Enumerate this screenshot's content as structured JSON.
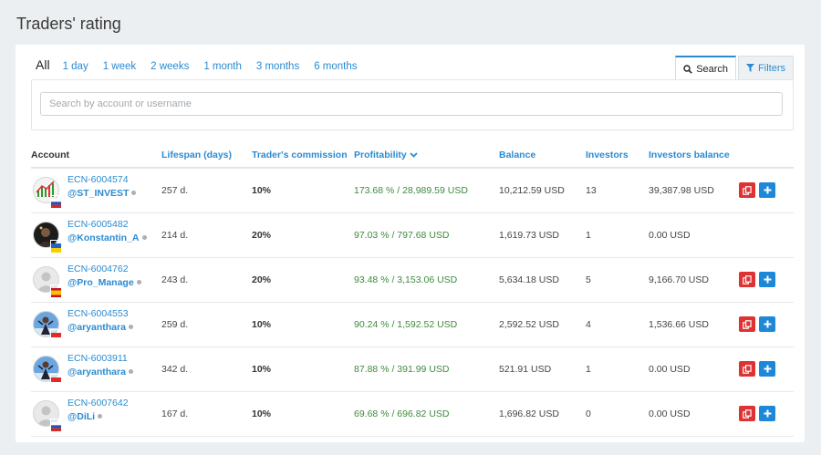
{
  "page": {
    "title": "Traders' rating"
  },
  "periods": {
    "active": "All",
    "links": [
      "1 day",
      "1 week",
      "2 weeks",
      "1 month",
      "3 months",
      "6 months"
    ]
  },
  "tabs": {
    "search": "Search",
    "filters": "Filters"
  },
  "search": {
    "placeholder": "Search by account or username",
    "value": ""
  },
  "columns": {
    "account": "Account",
    "lifespan": "Lifespan (days)",
    "commission": "Trader's commission",
    "profitability": "Profitability",
    "balance": "Balance",
    "investors": "Investors",
    "investors_balance": "Investors balance"
  },
  "rows": [
    {
      "account": "ECN-6004574",
      "username": "@ST_INVEST",
      "lifespan": "257 d.",
      "commission": "10%",
      "profitability": "173.68 % / 28,989.59 USD",
      "balance": "10,212.59 USD",
      "investors": "13",
      "investors_balance": "39,387.98 USD",
      "avatar": "chart",
      "flag": "ru",
      "has_copy": true,
      "has_add": true
    },
    {
      "account": "ECN-6005482",
      "username": "@Konstantin_A",
      "lifespan": "214 d.",
      "commission": "20%",
      "profitability": "97.03 % / 797.68 USD",
      "balance": "1,619.73 USD",
      "investors": "1",
      "investors_balance": "0.00 USD",
      "avatar": "dark",
      "flag": "ua",
      "has_copy": false,
      "has_add": false
    },
    {
      "account": "ECN-6004762",
      "username": "@Pro_Manage",
      "lifespan": "243 d.",
      "commission": "20%",
      "profitability": "93.48 % / 3,153.06 USD",
      "balance": "5,634.18 USD",
      "investors": "5",
      "investors_balance": "9,166.70 USD",
      "avatar": "default",
      "flag": "es",
      "has_copy": true,
      "has_add": true
    },
    {
      "account": "ECN-6004553",
      "username": "@aryanthara",
      "lifespan": "259 d.",
      "commission": "10%",
      "profitability": "90.24 % / 1,592.52 USD",
      "balance": "2,592.52 USD",
      "investors": "4",
      "investors_balance": "1,536.66 USD",
      "avatar": "photo",
      "flag": "id",
      "has_copy": true,
      "has_add": true
    },
    {
      "account": "ECN-6003911",
      "username": "@aryanthara",
      "lifespan": "342 d.",
      "commission": "10%",
      "profitability": "87.88 % / 391.99 USD",
      "balance": "521.91 USD",
      "investors": "1",
      "investors_balance": "0.00 USD",
      "avatar": "photo",
      "flag": "id",
      "has_copy": true,
      "has_add": true
    },
    {
      "account": "ECN-6007642",
      "username": "@DiLi",
      "lifespan": "167 d.",
      "commission": "10%",
      "profitability": "69.68 % / 696.82 USD",
      "balance": "1,696.82 USD",
      "investors": "0",
      "investors_balance": "0.00 USD",
      "avatar": "default",
      "flag": "ru",
      "has_copy": true,
      "has_add": true
    }
  ],
  "colors": {
    "accent": "#2a8bd1",
    "profit": "#3d8b3d",
    "copy_button": "#dd3333",
    "add_button": "#1e88d8"
  }
}
